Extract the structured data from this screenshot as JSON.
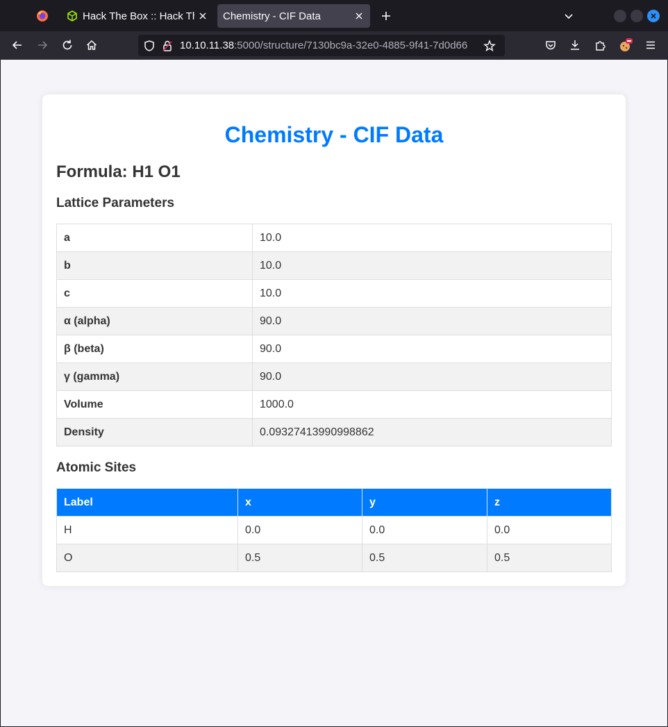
{
  "browser": {
    "tabs": [
      {
        "title": "Hack The Box :: Hack The Box",
        "active": false,
        "icon": "htb-cube-icon"
      },
      {
        "title": "Chemistry - CIF Data",
        "active": true
      }
    ],
    "url": {
      "host": "10.10.11.38",
      "rest": ":5000/structure/7130bc9a-32e0-4885-9f41-7d0d66"
    },
    "accent_color": "#2f8ff9"
  },
  "page": {
    "title": "Chemistry - CIF Data",
    "formula": "Formula: H1 O1",
    "lattice_heading": "Lattice Parameters",
    "lattice": [
      {
        "key": "a",
        "value": "10.0"
      },
      {
        "key": "b",
        "value": "10.0"
      },
      {
        "key": "c",
        "value": "10.0"
      },
      {
        "key": "α (alpha)",
        "value": "90.0"
      },
      {
        "key": "β (beta)",
        "value": "90.0"
      },
      {
        "key": "γ (gamma)",
        "value": "90.0"
      },
      {
        "key": "Volume",
        "value": "1000.0"
      },
      {
        "key": "Density",
        "value": "0.09327413990998862"
      }
    ],
    "sites_heading": "Atomic Sites",
    "sites_columns": [
      "Label",
      "x",
      "y",
      "z"
    ],
    "sites": [
      [
        "H",
        "0.0",
        "0.0",
        "0.0"
      ],
      [
        "O",
        "0.5",
        "0.5",
        "0.5"
      ]
    ],
    "title_color": "#007bff"
  }
}
